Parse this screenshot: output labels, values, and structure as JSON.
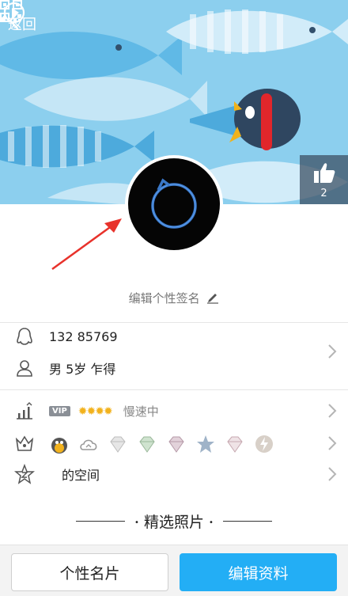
{
  "header": {
    "back_label": "返回",
    "like_count": "2"
  },
  "profile": {
    "signature_placeholder": "编辑个性签名",
    "account": "132  85769",
    "info": "男  5岁  乍得",
    "vip_badge": "VIP",
    "vip_level_icons": "✹✹✹✹",
    "vip_speed": "慢速中",
    "space_label": "的空间"
  },
  "section": {
    "title": "精选照片"
  },
  "actions": {
    "card_label": "个性名片",
    "edit_label": "编辑资料"
  },
  "colors": {
    "banner_bg": "#8ccfee",
    "primary": "#23aef5",
    "vip_sun": "#f2b21d"
  }
}
